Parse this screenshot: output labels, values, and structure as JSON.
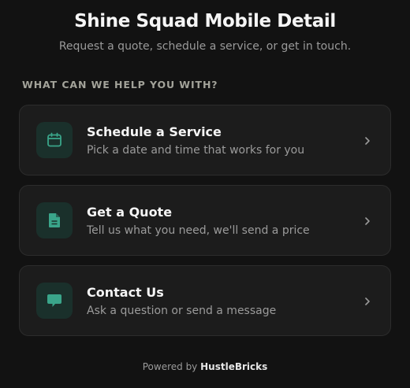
{
  "header": {
    "title": "Shine Squad Mobile Detail",
    "subtitle": "Request a quote, schedule a service, or get in touch."
  },
  "section": {
    "label": "WHAT CAN WE HELP YOU WITH?"
  },
  "options": [
    {
      "icon": "calendar-icon",
      "title": "Schedule a Service",
      "description": "Pick a date and time that works for you"
    },
    {
      "icon": "document-icon",
      "title": "Get a Quote",
      "description": "Tell us what you need, we'll send a price"
    },
    {
      "icon": "chat-bubble-icon",
      "title": "Contact Us",
      "description": "Ask a question or send a message"
    }
  ],
  "footer": {
    "prefix": "Powered by",
    "brand": "HustleBricks"
  },
  "colors": {
    "background": "#121212",
    "card": "#1c1c1c",
    "accent": "#3aa58a",
    "icon_bg": "#1a302b"
  }
}
